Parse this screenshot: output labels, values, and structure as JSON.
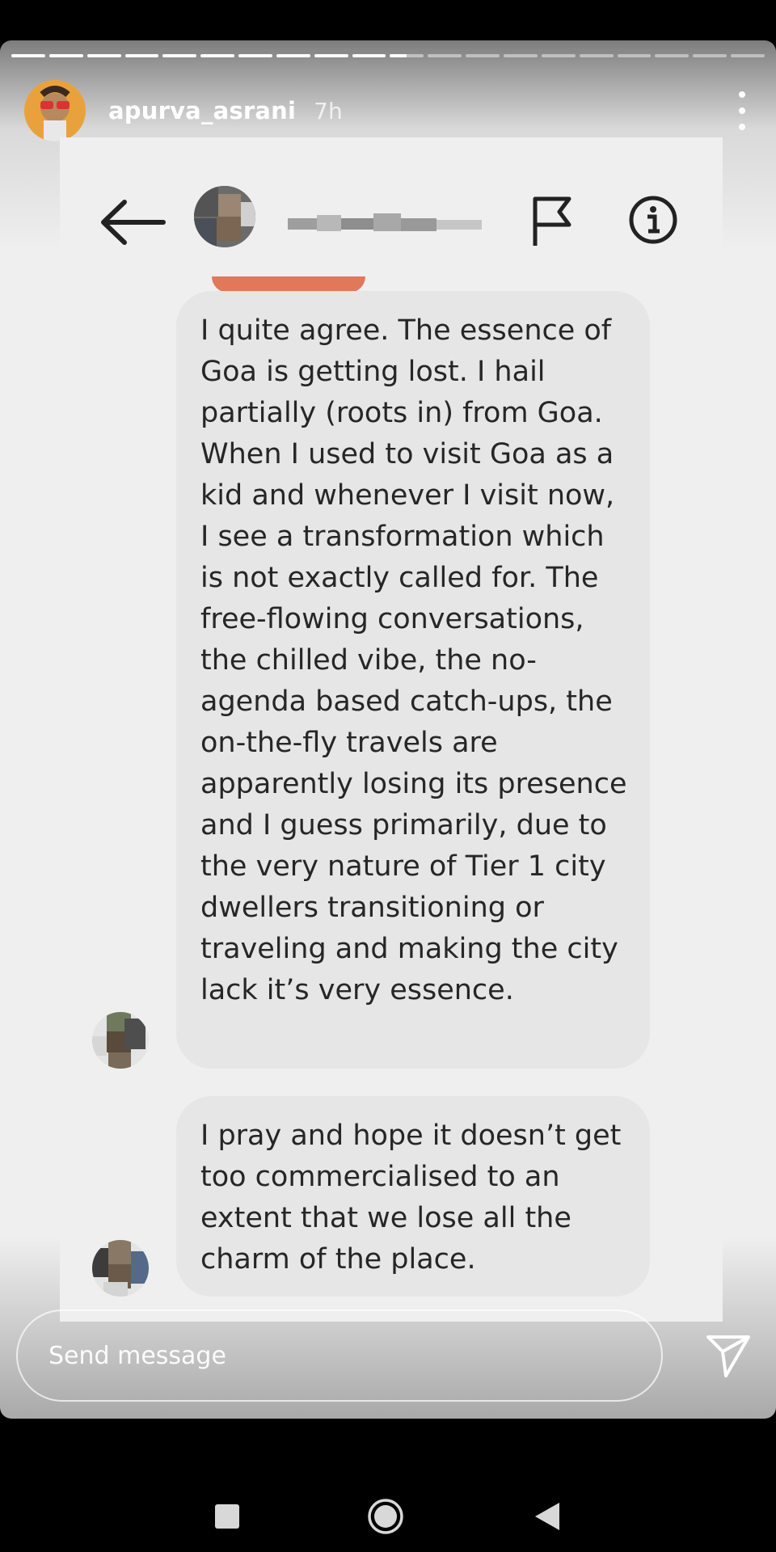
{
  "story": {
    "progress": {
      "segments": 20,
      "completed": 10,
      "current_fraction": 0.5
    },
    "username": "apurva_asrani",
    "time": "7h",
    "menu_icon": "more-vertical-icon",
    "avatar_icon": "profile-photo-avatar"
  },
  "dm": {
    "back_icon": "arrow-left-icon",
    "flag_icon": "flag-icon",
    "info_icon": "info-circle-icon",
    "avatar_icon": "blurred-avatar",
    "name_hidden": true,
    "messages": [
      {
        "text": "I quite agree. The essence of Goa is getting lost. I hail partially (roots in) from Goa. When I used to visit Goa as a kid and whenever I visit now, I see a transformation which is not exactly called for. The free-flowing conversations, the chilled vibe, the no-agenda based catch-ups, the on-the-fly travels are apparently losing its presence and I guess primarily, due to the very nature of Tier 1 city dwellers transitioning or traveling and making the city lack it’s very essence."
      },
      {
        "text": "I pray and hope it doesn’t get too commercialised to an extent that we lose all the charm of the place."
      }
    ]
  },
  "send": {
    "placeholder": "Send message",
    "send_icon": "paper-plane-icon"
  },
  "nav": {
    "recent_icon": "square-recents-icon",
    "home_icon": "circle-home-icon",
    "back_icon": "triangle-back-icon"
  },
  "colors": {
    "bubble": "#e6e6e6",
    "text": "#262626",
    "accent_prev_bubble": "#e2785a"
  }
}
